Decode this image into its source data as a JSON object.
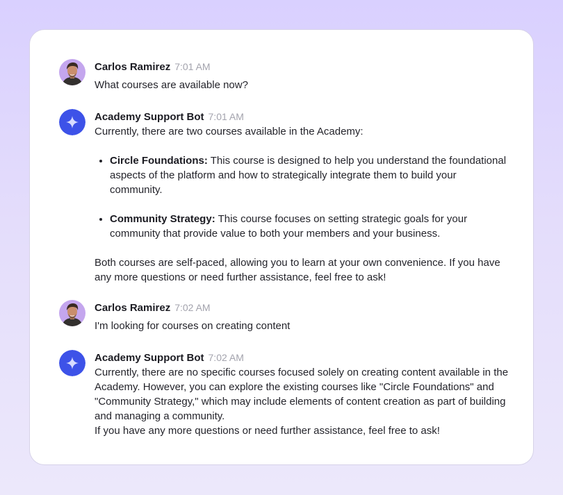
{
  "colors": {
    "background_top": "#d9d0ff",
    "background_bottom": "#ece8fb",
    "card": "#ffffff",
    "bot_avatar": "#3d52e8",
    "timestamp": "#a3a3ad"
  },
  "messages": [
    {
      "author": "Carlos Ramirez",
      "time": "7:01 AM",
      "avatar": "user-photo",
      "text": "What courses are available now?"
    },
    {
      "author": "Academy Support Bot",
      "time": "7:01 AM",
      "avatar": "sparkle-icon",
      "intro": "Currently, there are two courses available in the Academy:",
      "courses": [
        {
          "title": "Circle Foundations:",
          "description": " This course is designed to help you understand the foundational aspects of the platform and how to strategically integrate them to build your community."
        },
        {
          "title": "Community Strategy:",
          "description": " This course focuses on setting strategic goals for your community that provide value to both your members and your business."
        }
      ],
      "outro": "Both courses are self-paced, allowing you to learn at your own convenience. If you have any more questions or need further assistance, feel free to ask!"
    },
    {
      "author": "Carlos Ramirez",
      "time": "7:02 AM",
      "avatar": "user-photo",
      "text": "I'm looking for courses on creating content"
    },
    {
      "author": "Academy Support Bot",
      "time": "7:02 AM",
      "avatar": "sparkle-icon",
      "text": "Currently, there are no specific courses focused solely on creating content available in the Academy. However, you can explore the existing courses like \"Circle Foundations\" and \"Community Strategy,\" which may include elements of content creation as part of building and managing a community.",
      "text2": "If you have any more questions or need further assistance, feel free to ask!"
    }
  ]
}
